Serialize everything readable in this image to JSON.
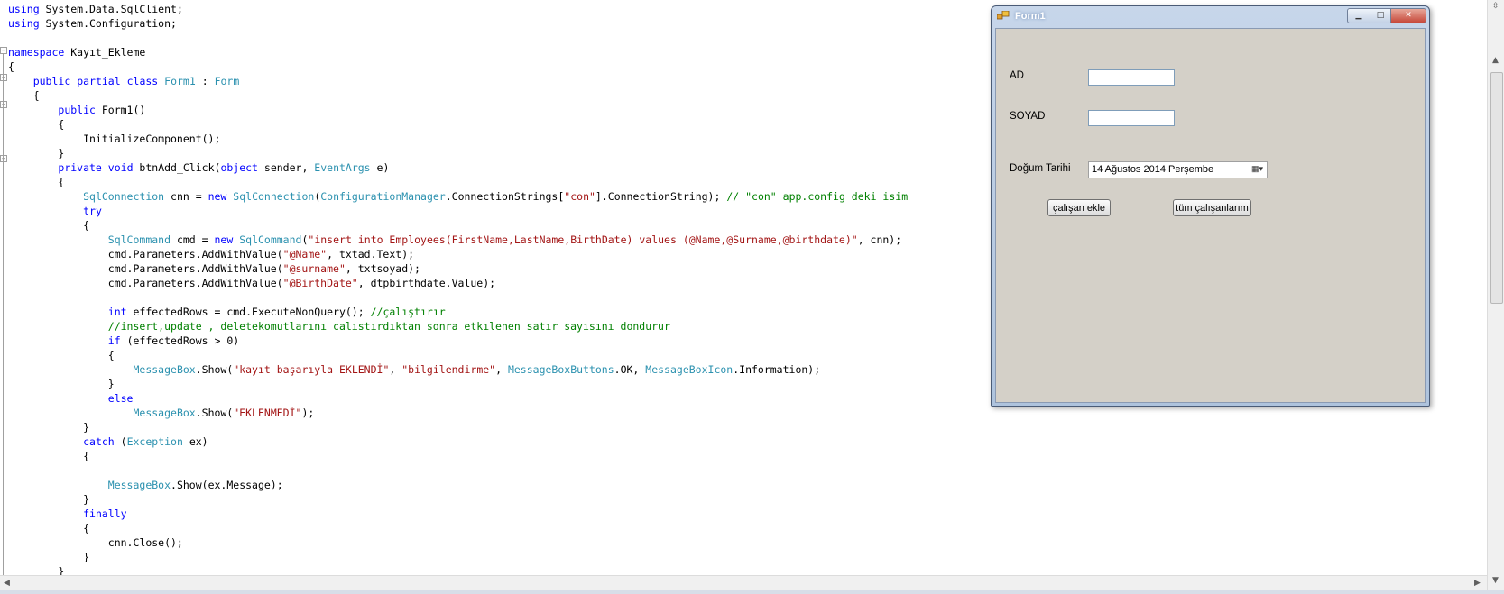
{
  "editor": {
    "lines": [
      [
        {
          "t": "using",
          "c": "kw"
        },
        {
          "t": " System.Data.SqlClient;"
        }
      ],
      [
        {
          "t": "using",
          "c": "kw"
        },
        {
          "t": " System.Configuration;"
        }
      ],
      [],
      [
        {
          "t": "namespace",
          "c": "kw"
        },
        {
          "t": " Kayıt_Ekleme"
        }
      ],
      [
        {
          "t": "{"
        }
      ],
      [
        {
          "t": "    "
        },
        {
          "t": "public",
          "c": "kw"
        },
        {
          "t": " "
        },
        {
          "t": "partial",
          "c": "kw"
        },
        {
          "t": " "
        },
        {
          "t": "class",
          "c": "kw"
        },
        {
          "t": " "
        },
        {
          "t": "Form1",
          "c": "ty"
        },
        {
          "t": " : "
        },
        {
          "t": "Form",
          "c": "ty"
        }
      ],
      [
        {
          "t": "    {"
        }
      ],
      [
        {
          "t": "        "
        },
        {
          "t": "public",
          "c": "kw"
        },
        {
          "t": " Form1()"
        }
      ],
      [
        {
          "t": "        {"
        }
      ],
      [
        {
          "t": "            InitializeComponent();"
        }
      ],
      [
        {
          "t": "        }"
        }
      ],
      [
        {
          "t": "        "
        },
        {
          "t": "private",
          "c": "kw"
        },
        {
          "t": " "
        },
        {
          "t": "void",
          "c": "kw"
        },
        {
          "t": " btnAdd_Click("
        },
        {
          "t": "object",
          "c": "kw"
        },
        {
          "t": " sender, "
        },
        {
          "t": "EventArgs",
          "c": "ty"
        },
        {
          "t": " e)"
        }
      ],
      [
        {
          "t": "        {"
        }
      ],
      [
        {
          "t": "            "
        },
        {
          "t": "SqlConnection",
          "c": "ty"
        },
        {
          "t": " cnn = "
        },
        {
          "t": "new",
          "c": "kw"
        },
        {
          "t": " "
        },
        {
          "t": "SqlConnection",
          "c": "ty"
        },
        {
          "t": "("
        },
        {
          "t": "ConfigurationManager",
          "c": "ty"
        },
        {
          "t": ".ConnectionStrings["
        },
        {
          "t": "\"con\"",
          "c": "st"
        },
        {
          "t": "].ConnectionString); "
        },
        {
          "t": "// \"con\" app.config deki isim",
          "c": "cm"
        }
      ],
      [
        {
          "t": "            "
        },
        {
          "t": "try",
          "c": "kw"
        }
      ],
      [
        {
          "t": "            {"
        }
      ],
      [
        {
          "t": "                "
        },
        {
          "t": "SqlCommand",
          "c": "ty"
        },
        {
          "t": " cmd = "
        },
        {
          "t": "new",
          "c": "kw"
        },
        {
          "t": " "
        },
        {
          "t": "SqlCommand",
          "c": "ty"
        },
        {
          "t": "("
        },
        {
          "t": "\"insert into Employees(FirstName,LastName,BirthDate) values (@Name,@Surname,@birthdate)\"",
          "c": "st"
        },
        {
          "t": ", cnn);"
        }
      ],
      [
        {
          "t": "                cmd.Parameters.AddWithValue("
        },
        {
          "t": "\"@Name\"",
          "c": "st"
        },
        {
          "t": ", txtad.Text);"
        }
      ],
      [
        {
          "t": "                cmd.Parameters.AddWithValue("
        },
        {
          "t": "\"@surname\"",
          "c": "st"
        },
        {
          "t": ", txtsoyad);"
        }
      ],
      [
        {
          "t": "                cmd.Parameters.AddWithValue("
        },
        {
          "t": "\"@BirthDate\"",
          "c": "st"
        },
        {
          "t": ", dtpbirthdate.Value);"
        }
      ],
      [],
      [
        {
          "t": "                "
        },
        {
          "t": "int",
          "c": "kw"
        },
        {
          "t": " effectedRows = cmd.ExecuteNonQuery(); "
        },
        {
          "t": "//çalıştırır",
          "c": "cm"
        }
      ],
      [
        {
          "t": "                "
        },
        {
          "t": "//insert,update , deletekomutlarını calıstırdıktan sonra etkılenen satır sayısını dondurur",
          "c": "cm"
        }
      ],
      [
        {
          "t": "                "
        },
        {
          "t": "if",
          "c": "kw"
        },
        {
          "t": " (effectedRows > 0)"
        }
      ],
      [
        {
          "t": "                {"
        }
      ],
      [
        {
          "t": "                    "
        },
        {
          "t": "MessageBox",
          "c": "ty"
        },
        {
          "t": ".Show("
        },
        {
          "t": "\"kayıt başarıyla EKLENDİ\"",
          "c": "st"
        },
        {
          "t": ", "
        },
        {
          "t": "\"bilgilendirme\"",
          "c": "st"
        },
        {
          "t": ", "
        },
        {
          "t": "MessageBoxButtons",
          "c": "ty"
        },
        {
          "t": ".OK, "
        },
        {
          "t": "MessageBoxIcon",
          "c": "ty"
        },
        {
          "t": ".Information);"
        }
      ],
      [
        {
          "t": "                }"
        }
      ],
      [
        {
          "t": "                "
        },
        {
          "t": "else",
          "c": "kw"
        }
      ],
      [
        {
          "t": "                    "
        },
        {
          "t": "MessageBox",
          "c": "ty"
        },
        {
          "t": ".Show("
        },
        {
          "t": "\"EKLENMEDİ\"",
          "c": "st"
        },
        {
          "t": ");"
        }
      ],
      [
        {
          "t": "            }"
        }
      ],
      [
        {
          "t": "            "
        },
        {
          "t": "catch",
          "c": "kw"
        },
        {
          "t": " ("
        },
        {
          "t": "Exception",
          "c": "ty"
        },
        {
          "t": " ex)"
        }
      ],
      [
        {
          "t": "            {"
        }
      ],
      [],
      [
        {
          "t": "                "
        },
        {
          "t": "MessageBox",
          "c": "ty"
        },
        {
          "t": ".Show(ex.Message);"
        }
      ],
      [
        {
          "t": "            }"
        }
      ],
      [
        {
          "t": "            "
        },
        {
          "t": "finally",
          "c": "kw"
        }
      ],
      [
        {
          "t": "            {"
        }
      ],
      [
        {
          "t": "                cnn.Close();"
        }
      ],
      [
        {
          "t": "            }"
        }
      ],
      [
        {
          "t": "        }"
        }
      ]
    ]
  },
  "form": {
    "title": "Form1",
    "labels": {
      "ad": "AD",
      "soyad": "SOYAD",
      "dogum": "Doğum Tarihi"
    },
    "inputs": {
      "ad_value": "",
      "soyad_value": ""
    },
    "date_value": "14 Ağustos 2014 Perşembe",
    "buttons": {
      "add": "çalışan ekle",
      "all": "tüm çalışanlarım"
    }
  },
  "colors": {
    "keyword": "#0000ff",
    "type": "#2b91af",
    "string": "#a31515",
    "comment": "#008000"
  }
}
